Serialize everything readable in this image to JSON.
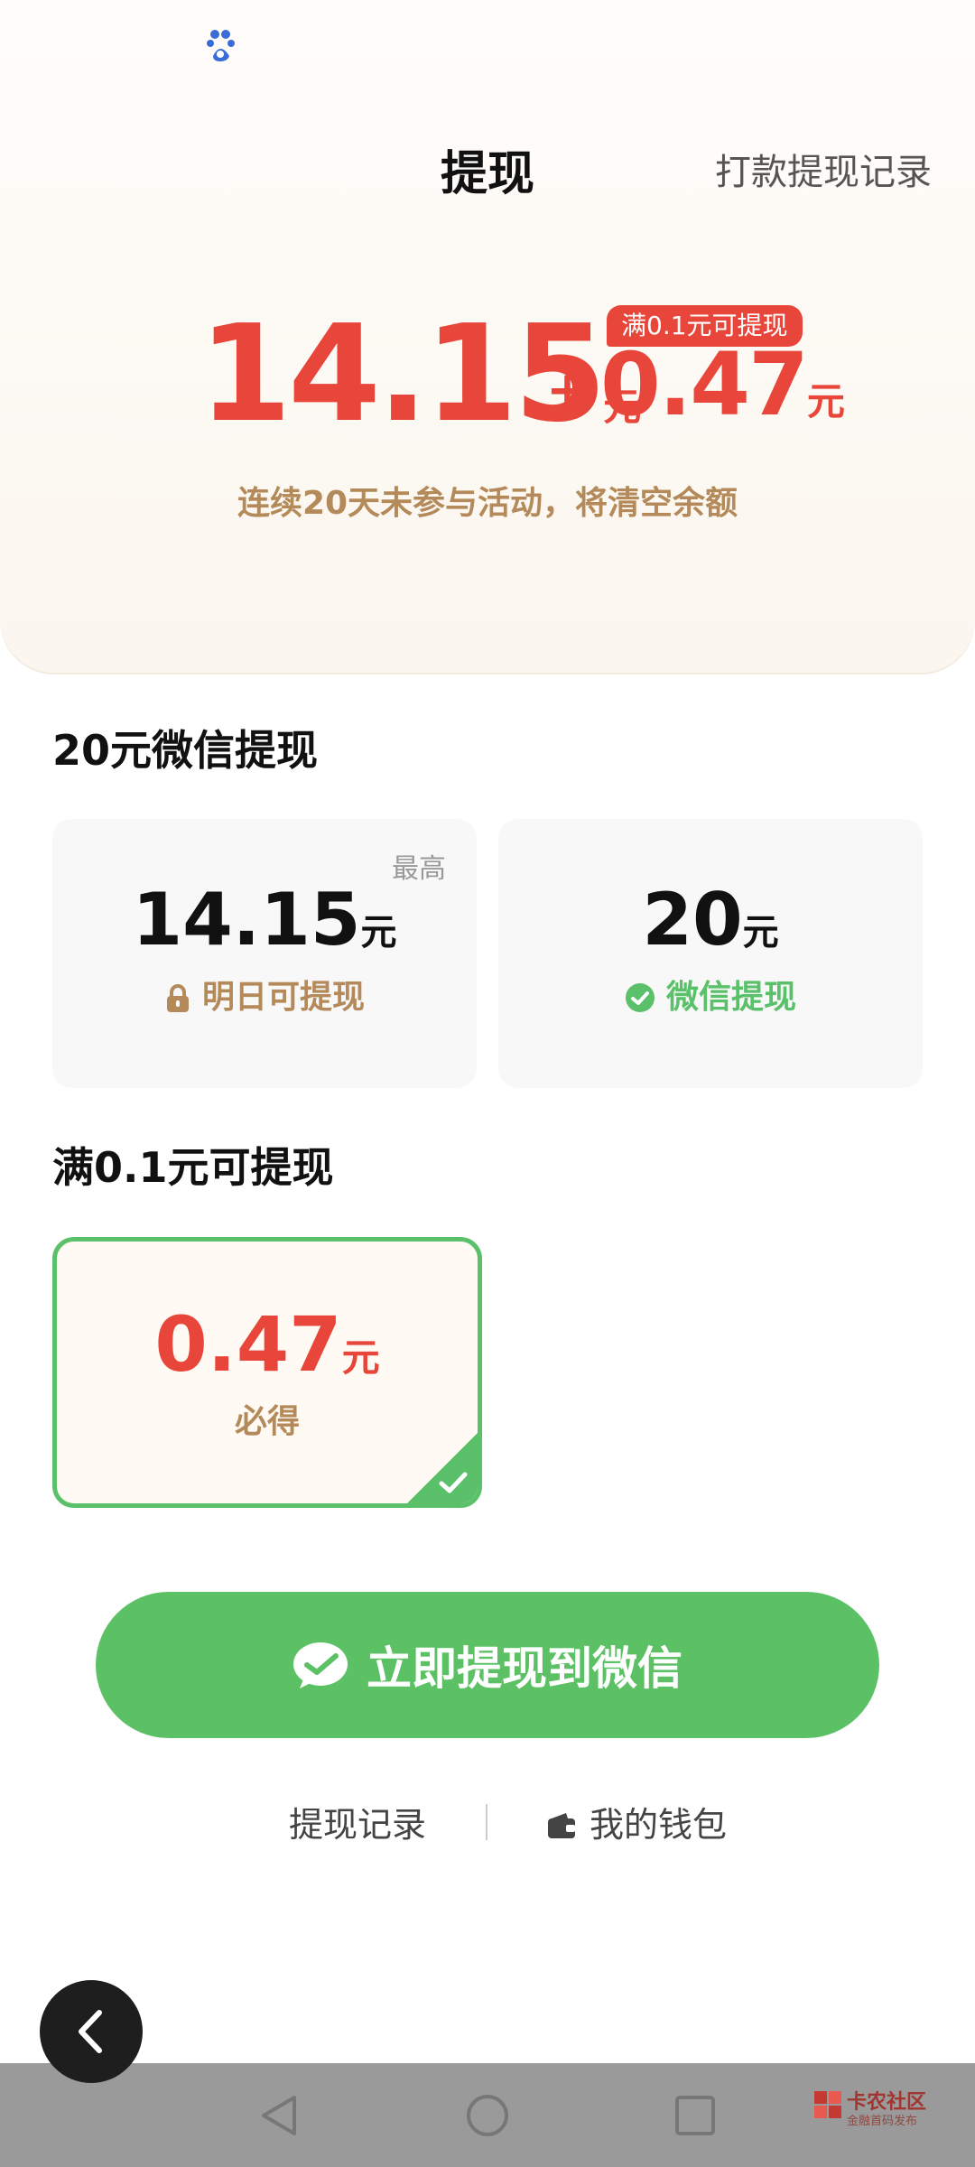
{
  "header": {
    "title": "提现",
    "history_link": "打款提现记录"
  },
  "balance": {
    "main_amount": "14.15",
    "main_unit": "元",
    "plus": "+",
    "extra_amount": "0.47",
    "extra_unit": "元",
    "threshold_badge": "满0.1元可提现",
    "warning": "连续20天未参与活动，将清空余额"
  },
  "section_wechat": {
    "title": "20元微信提现",
    "card_left": {
      "top_label": "最高",
      "amount": "14.15",
      "unit": "元",
      "sub_label": "明日可提现",
      "icon": "lock-icon"
    },
    "card_right": {
      "amount": "20",
      "unit": "元",
      "sub_label": "微信提现",
      "icon": "wechat-icon"
    }
  },
  "section_threshold": {
    "title": "满0.1元可提现",
    "selected_card": {
      "amount": "0.47",
      "unit": "元",
      "sub_label": "必得",
      "icon": "check-icon"
    }
  },
  "actions": {
    "withdraw_button": "立即提现到微信",
    "records_link": "提现记录",
    "wallet_link": "我的钱包"
  },
  "watermark": {
    "title": "卡农社区",
    "subtitle": "金融首码发布"
  },
  "colors": {
    "accent_red": "#e8463a",
    "accent_green": "#5ac16a",
    "text_brown": "#b48a5a"
  }
}
